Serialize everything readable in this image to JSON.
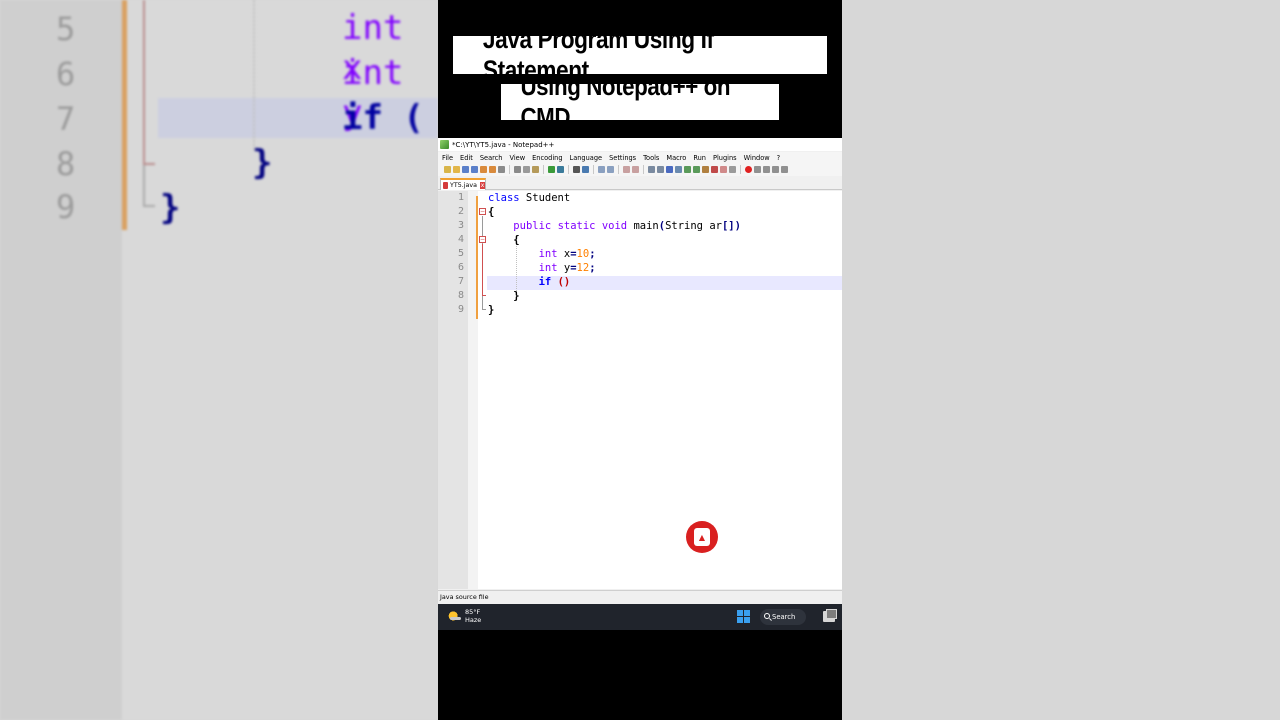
{
  "video": {
    "title_line1": "Java Program Using If Statement",
    "title_line2": "Using Notepad++ on CMD"
  },
  "window": {
    "title": "*C:\\YT\\YT5.java - Notepad++"
  },
  "menu": [
    "File",
    "Edit",
    "Search",
    "View",
    "Encoding",
    "Language",
    "Settings",
    "Tools",
    "Macro",
    "Run",
    "Plugins",
    "Window",
    "?"
  ],
  "tab": {
    "label": "YT5.java",
    "close": "x"
  },
  "code": {
    "line_numbers": [
      "1",
      "2",
      "3",
      "4",
      "5",
      "6",
      "7",
      "8",
      "9"
    ],
    "lines": [
      "class Student",
      "{",
      "    public static void main(String ar[])",
      "    {",
      "        int x=10;",
      "        int y=12;",
      "        if ()",
      "    }",
      "}"
    ],
    "current_line": 7
  },
  "status": {
    "file_type": "Java source file"
  },
  "taskbar": {
    "temperature": "85°F",
    "condition": "Haze",
    "search_label": "Search"
  },
  "background_zoom": {
    "line_numbers": [
      "5",
      "6",
      "7",
      "8",
      "9"
    ],
    "lines": [
      "int x",
      "int y",
      "if (",
      "}",
      "}"
    ]
  },
  "colors": {
    "keyword": "#0000ff",
    "type_keyword": "#8000ff",
    "number": "#ff8000",
    "operator": "#000080",
    "current_line_bg": "#e8e8ff",
    "change_bar": "#f0a040",
    "record_button": "#d92020",
    "taskbar_bg": "#20242c"
  }
}
